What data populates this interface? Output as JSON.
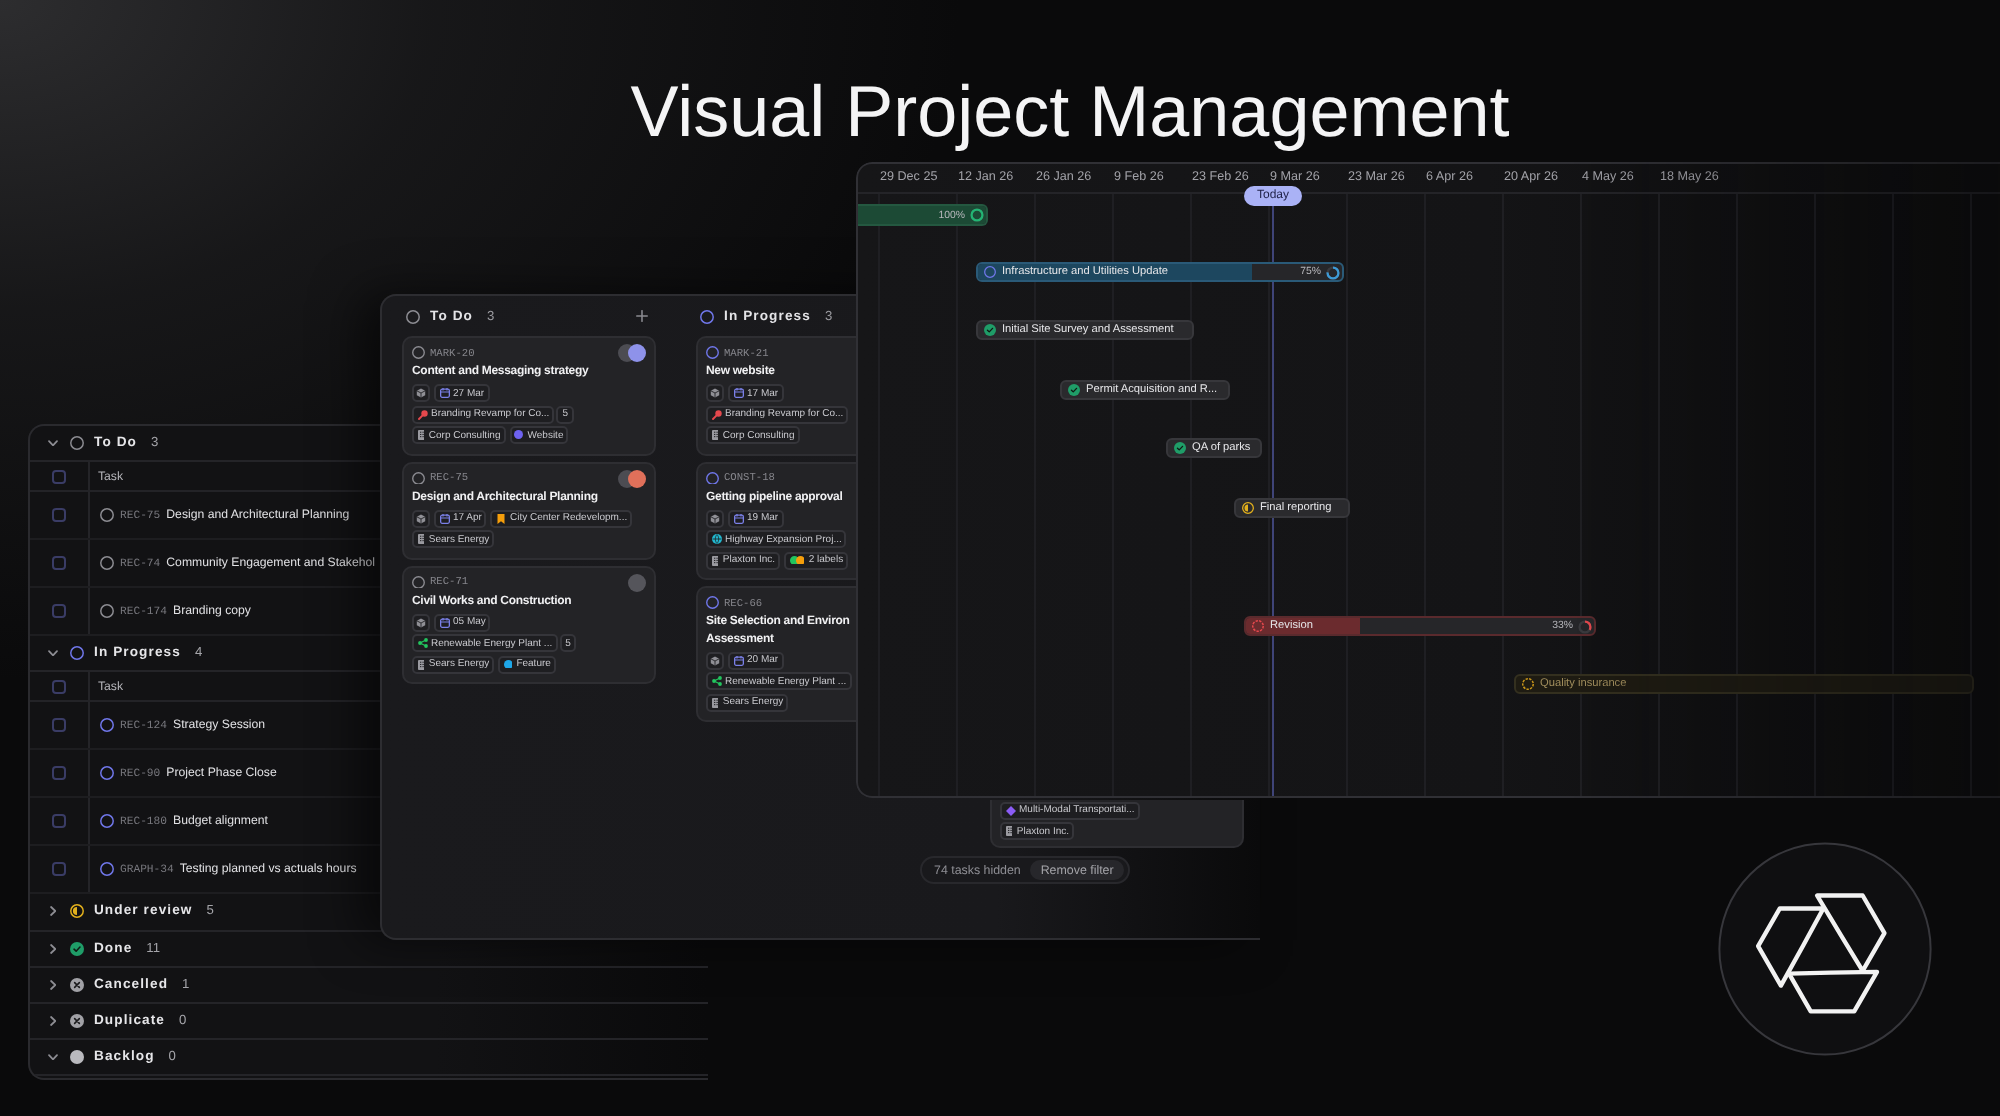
{
  "headline": "Visual Project Management",
  "list_view": {
    "groups": [
      {
        "kind": "todo",
        "label": "To Do",
        "count": "3",
        "expanded": true,
        "header": {
          "label": "Task",
          "checked": false
        },
        "rows": [
          {
            "id": "REC-75",
            "title": "Design and Architectural Planning",
            "checked": false
          },
          {
            "id": "REC-74",
            "title": "Community Engagement and Stakehol",
            "checked": false
          },
          {
            "id": "REC-174",
            "title": "Branding copy",
            "checked": false
          }
        ]
      },
      {
        "kind": "in_progress",
        "label": "In Progress",
        "count": "4",
        "expanded": true,
        "header": {
          "label": "Task",
          "checked": false
        },
        "rows": [
          {
            "id": "REC-124",
            "title": "Strategy Session",
            "checked": false
          },
          {
            "id": "REC-90",
            "title": "Project Phase Close",
            "checked": false
          },
          {
            "id": "REC-180",
            "title": "Budget alignment",
            "checked": false
          },
          {
            "id": "GRAPH-34",
            "title": "Testing planned vs actuals hours",
            "checked": false
          }
        ]
      },
      {
        "kind": "in_review",
        "label": "Under review",
        "count": "5",
        "expanded": false
      },
      {
        "kind": "done",
        "label": "Done",
        "count": "11",
        "expanded": false
      },
      {
        "kind": "cancelled",
        "label": "Cancelled",
        "count": "1",
        "expanded": false
      },
      {
        "kind": "duplicate",
        "label": "Duplicate",
        "count": "0",
        "expanded": false
      },
      {
        "kind": "backlog",
        "label": "Backlog",
        "count": "0",
        "expanded": true
      }
    ]
  },
  "board": {
    "columns": [
      {
        "kind": "todo",
        "label": "To Do",
        "count": "3",
        "add": true,
        "cards": [
          {
            "id": "MARK-20",
            "title": "Content and Messaging strategy",
            "assignees": [
              {
                "color": "#4c4c52"
              },
              {
                "color": "#8e92ea"
              }
            ],
            "due": "27 Mar",
            "project": {
              "name": "Branding Revamp for Co...",
              "kind": "pin",
              "color": "#e5484d"
            },
            "estimate": "5",
            "client": "Corp Consulting",
            "labels": [
              {
                "name": "Website",
                "dots": [
                  {
                    "color": "#6e62f0"
                  }
                ]
              }
            ]
          },
          {
            "id": "REC-75",
            "title": "Design and Architectural Planning",
            "assignees": [
              {
                "color": "#4c4c52"
              },
              {
                "color": "#e0705a"
              }
            ],
            "due": "17 Apr",
            "project": {
              "name": "City Center Redevelopm...",
              "kind": "bookmark",
              "color": "#f59e0b"
            },
            "client": "Sears Energy"
          },
          {
            "id": "REC-71",
            "title": "Civil Works and Construction",
            "assignees": [
              {
                "color": "#55555b"
              }
            ],
            "due": "05 May",
            "project": {
              "name": "Renewable Energy Plant ...",
              "kind": "nodes",
              "color": "#22c55e"
            },
            "estimate": "5",
            "client": "Sears Energy",
            "labels": [
              {
                "name": "Feature",
                "dots": [
                  {
                    "color": "#1ea7e8"
                  }
                ]
              }
            ]
          }
        ]
      },
      {
        "kind": "in_progress",
        "label": "In Progress",
        "count": "3",
        "cards": [
          {
            "id": "MARK-21",
            "title": "New website",
            "due": "17 Mar",
            "project": {
              "name": "Branding Revamp for Co...",
              "kind": "pin",
              "color": "#e5484d"
            },
            "client": "Corp Consulting"
          },
          {
            "id": "CONST-18",
            "title": "Getting pipeline approval",
            "due": "19 Mar",
            "project": {
              "name": "Highway Expansion Proj...",
              "kind": "globe",
              "color": "#22b8cf"
            },
            "client": "Plaxton Inc.",
            "labels": [
              {
                "name": "2 labels",
                "dots": [
                  {
                    "color": "#22c55e"
                  },
                  {
                    "color": "#f59e0b"
                  }
                ]
              }
            ]
          },
          {
            "id": "REC-66",
            "title": "Site Selection and Environ\nAssessment",
            "due": "20 Mar",
            "project": {
              "name": "Renewable Energy Plant ...",
              "kind": "nodes",
              "color": "#22c55e"
            },
            "client": "Sears Energy"
          }
        ]
      },
      {
        "cards": [
          {
            "project": {
              "name": "Multi-Modal Transportati...",
              "kind": "diamond",
              "color": "#8b5cf6"
            },
            "client": "Plaxton Inc."
          }
        ]
      }
    ],
    "filter_notice": {
      "text": "74 tasks hidden",
      "button": "Remove filter"
    }
  },
  "timeline": {
    "dates": [
      "29 Dec 25",
      "12 Jan 26",
      "26 Jan 26",
      "9 Feb 26",
      "23 Feb 26",
      "9 Mar 26",
      "23 Mar 26",
      "6 Apr 26",
      "20 Apr 26",
      "4 May 26",
      "18 May 26"
    ],
    "today": "Today",
    "bars": [
      {
        "kind": "done",
        "level": 1,
        "reading": "100%"
      },
      {
        "kind": "in_progress",
        "title": "Infrastructure and Utilities Update",
        "level": 0.75,
        "reading": "75%"
      },
      {
        "kind": "done",
        "title": "Initial Site Survey and Assessment"
      },
      {
        "kind": "done",
        "title": "Permit Acquisition and R..."
      },
      {
        "kind": "done",
        "title": "QA of parks"
      },
      {
        "kind": "in_review",
        "title": "Final reporting"
      },
      {
        "kind": "blocked",
        "title": "Revision",
        "level": 0.33,
        "reading": "33%"
      },
      {
        "kind": "on_hold",
        "title": "Quality insurance"
      }
    ]
  }
}
